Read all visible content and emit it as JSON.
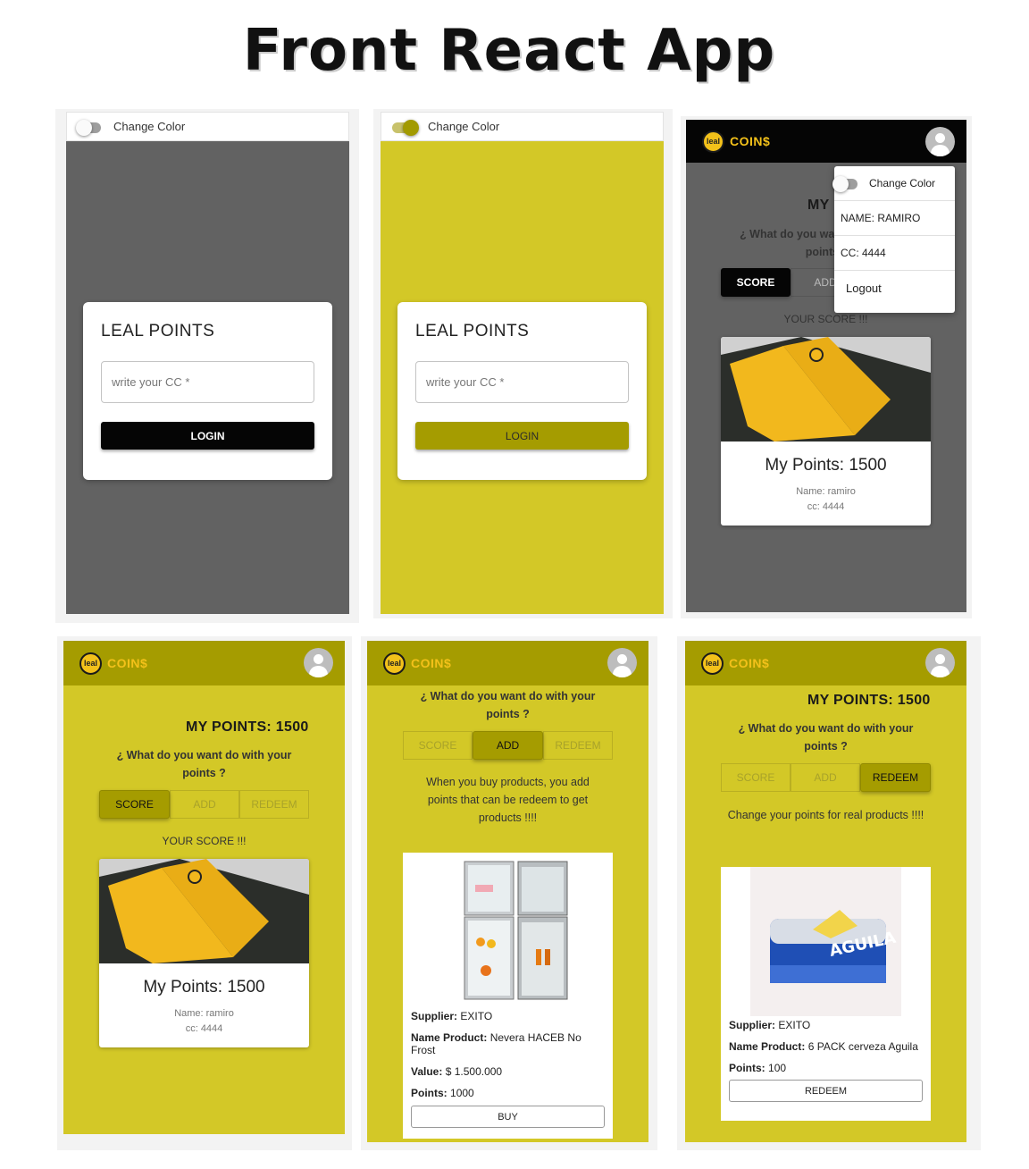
{
  "title": "Front React App",
  "colors": {
    "gray_bg": "#626262",
    "yellow_bg": "#d3c827",
    "dark_yellow": "#a59c00",
    "black": "#050505",
    "logo_yellow": "#f3c11a"
  },
  "login": {
    "toggle_label": "Change Color",
    "card_title": "LEAL POINTS",
    "cc_placeholder": "write your CC *",
    "login_label": "LOGIN"
  },
  "app": {
    "logo_mark": "leal",
    "logo_text": "COIN$",
    "my_points_label": "MY POINTS: 1500",
    "question": "¿ What do you want do with your points ?",
    "tabs": [
      "SCORE",
      "ADD",
      "REDEEM"
    ],
    "your_score": "YOUR SCORE !!!",
    "card_points": "My Points: 1500",
    "card_name": "Name: ramiro",
    "card_cc": "cc: 4444"
  },
  "menu": {
    "toggle_label": "Change Color",
    "name": "NAME: RAMIRO",
    "cc": "CC: 4444",
    "logout": "Logout"
  },
  "add_screen": {
    "description": "When you buy products, you add points that can be redeem to get products !!!!",
    "supplier_label": "Supplier:",
    "supplier": "EXITO",
    "name_label": "Name Product:",
    "name": "Nevera HACEB No Frost",
    "value_label": "Value:",
    "value": "$ 1.500.000",
    "points_label": "Points:",
    "points": "1000",
    "button": "BUY"
  },
  "redeem_screen": {
    "description": "Change your points for real products !!!!",
    "supplier_label": "Supplier:",
    "supplier": "EXITO",
    "name_label": "Name Product:",
    "name": "6 PACK cerveza Aguila",
    "points_label": "Points:",
    "points": "100",
    "button": "REDEEM",
    "can_text": "AGUILA"
  }
}
